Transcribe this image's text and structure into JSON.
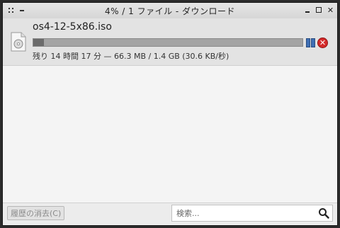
{
  "window": {
    "title": "4% / 1 ファイル - ダウンロード",
    "close_glyph": "✕"
  },
  "download": {
    "filename": "os4-12-5x86.iso",
    "progress": 0.04,
    "status": "残り 14 時間 17 分 — 66.3 MB / 1.4 GB (30.6 KB/秒)",
    "cancel_glyph": "✕"
  },
  "footer": {
    "clear_history_label": "履歴の消去(C)",
    "search_placeholder": "検索..."
  },
  "icons": {
    "file": "disc-file-icon",
    "pause": "pause-icon",
    "cancel": "cancel-icon",
    "search": "search-icon"
  },
  "colors": {
    "accent_pause": "#3f6fb5",
    "cancel_red": "#d42a2a",
    "progress_fill": "#6b6b6b"
  }
}
